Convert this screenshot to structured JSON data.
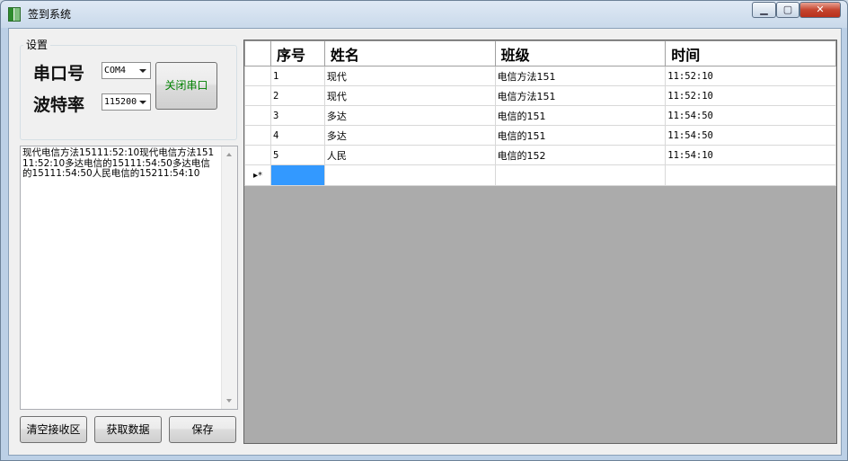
{
  "window": {
    "title": "签到系统",
    "controls": [
      "minimize",
      "maximize",
      "close"
    ]
  },
  "settings": {
    "group_title": "设置",
    "port_label": "串口号",
    "port_value": "COM4",
    "baud_label": "波特率",
    "baud_value": "115200",
    "toggle_port_button": "关闭串口"
  },
  "receive_text": "现代电信方法15111:52:10现代电信方法15111:52:10多达电信的15111:54:50多达电信的15111:54:50人民电信的15211:54:10",
  "buttons": {
    "clear": "清空接收区",
    "fetch": "获取数据",
    "save": "保存"
  },
  "grid": {
    "columns": [
      "序号",
      "姓名",
      "班级",
      "时间"
    ],
    "rows": [
      [
        "1",
        "现代",
        "电信方法151",
        "11:52:10"
      ],
      [
        "2",
        "现代",
        "电信方法151",
        "11:52:10"
      ],
      [
        "3",
        "多达",
        "电信的151",
        "11:54:50"
      ],
      [
        "4",
        "多达",
        "电信的151",
        "11:54:50"
      ],
      [
        "5",
        "人民",
        "电信的152",
        "11:54:10"
      ]
    ],
    "new_row_marker": "▸*"
  },
  "colors": {
    "selection": "#3399ff",
    "grid_background": "#ababab",
    "port_button_text": "#008000"
  }
}
